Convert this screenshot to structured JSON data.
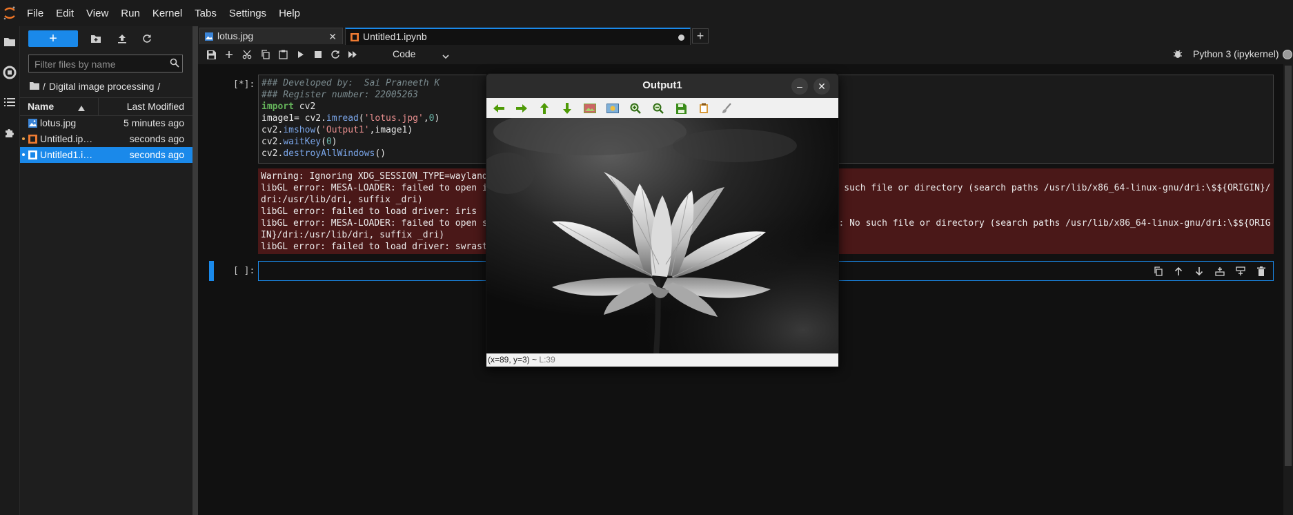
{
  "menubar": {
    "items": [
      "File",
      "Edit",
      "View",
      "Run",
      "Kernel",
      "Tabs",
      "Settings",
      "Help"
    ]
  },
  "activity_bar": {
    "icons": [
      "folder-icon",
      "running-icon",
      "toc-icon",
      "extension-icon"
    ]
  },
  "file_browser": {
    "new_label": "+",
    "filter_placeholder": "Filter files by name",
    "breadcrumb": [
      "Digital image processing"
    ],
    "breadcrumb_sep": "/",
    "columns": {
      "name": "Name",
      "modified": "Last Modified"
    },
    "files": [
      {
        "name": "lotus.jpg",
        "modified": "5 minutes ago",
        "type": "image",
        "running": false,
        "selected": false
      },
      {
        "name": "Untitled.ipynb",
        "modified": "seconds ago",
        "type": "notebook",
        "running": true,
        "selected": false
      },
      {
        "name": "Untitled1.ipynb",
        "modified": "seconds ago",
        "type": "notebook",
        "running": true,
        "selected": true
      }
    ]
  },
  "tabs": [
    {
      "label": "lotus.jpg",
      "active": false
    },
    {
      "label": "Untitled1.ipynb",
      "active": true,
      "unsaved": true
    }
  ],
  "toolbar": {
    "cell_type": "Code",
    "kernel_name": "Python 3 (ipykernel)"
  },
  "cells": [
    {
      "prompt": "[*]:",
      "code": [
        "### Developed by:  Sai Praneeth K",
        "### Register number: 22005263",
        "import cv2",
        "image1= cv2.imread('lotus.jpg',0)",
        "cv2.imshow('Output1',image1)",
        "cv2.waitKey(0)",
        "cv2.destroyAllWindows()"
      ],
      "output": [
        "Warning: Ignoring XDG_SESSION_TYPE=wayland on Gnome. Use QT_QPA_PLATFORM=wayland to run on Wayland anyway.",
        "libGL error: MESA-LOADER: failed to open iris: /usr/lib/dri/iris_dri.so: cannot open shared object file: No such file or directory (search paths /usr/lib/x86_64-linux-gnu/dri:\\$${ORIGIN}/",
        "dri:/usr/lib/dri, suffix _dri)",
        "libGL error: failed to load driver: iris",
        "libGL error: MESA-LOADER: failed to open swrast: /usr/lib/dri/swrast_dri.so: cannot open shared object file: No such file or directory (search paths /usr/lib/x86_64-linux-gnu/dri:\\$${ORIG",
        "IN}/dri:/usr/lib/dri, suffix _dri)",
        "libGL error: failed to load driver: swrast"
      ]
    },
    {
      "prompt": "[ ]:",
      "code": []
    }
  ],
  "cv_window": {
    "title": "Output1",
    "minimize": "–",
    "close": "✕",
    "status_coords": "(x=89, y=3) ~",
    "status_value": "L:39"
  }
}
